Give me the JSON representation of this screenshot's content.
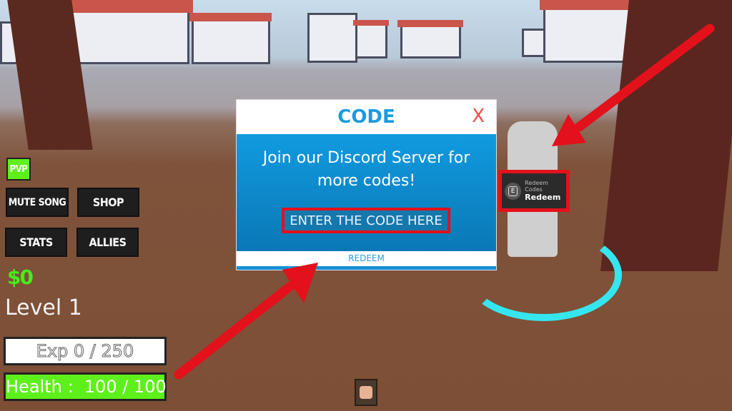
{
  "dialog": {
    "title": "CODE",
    "close": "X",
    "message": "Join our Discord Server for more codes!",
    "input_placeholder": "ENTER THE CODE HERE",
    "redeem": "REDEEM"
  },
  "hud": {
    "pvp": "PVP",
    "mute_song": "MUTE SONG",
    "shop": "SHOP",
    "stats": "STATS",
    "allies": "ALLIES",
    "money": "$0",
    "level": "Level 1",
    "exp": "Exp 0 / 250",
    "exp_fraction": 0,
    "health": "Health :  100 / 100",
    "health_fraction": 1
  },
  "prompt": {
    "key": "E",
    "subtitle": "Redeem Codes",
    "action": "Redeem"
  },
  "colors": {
    "accent": "#1a9be0",
    "close": "#e84c4c",
    "health": "#5ef01a",
    "money": "#4bea1a",
    "highlight": "#e3111b"
  },
  "hotbar": {
    "slot_icon": "fist-icon"
  }
}
